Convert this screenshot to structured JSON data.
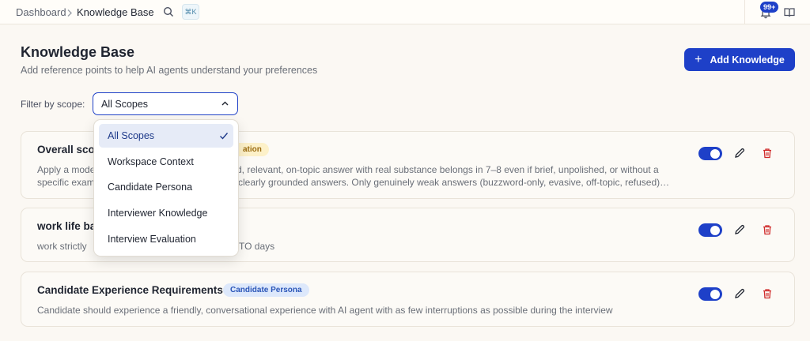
{
  "header": {
    "breadcrumb_root": "Dashboard",
    "breadcrumb_current": "Knowledge Base",
    "shortcut": "⌘K",
    "notification_count": "99+"
  },
  "page": {
    "title": "Knowledge Base",
    "subtitle": "Add reference points to help AI agents understand your preferences",
    "add_label": "Add Knowledge"
  },
  "filter": {
    "label": "Filter by scope:",
    "selected": "All Scopes",
    "options": [
      "All Scopes",
      "Workspace Context",
      "Candidate Persona",
      "Interviewer Knowledge",
      "Interview Evaluation"
    ]
  },
  "cards": [
    {
      "title_visible": "Overall sco",
      "scope_visible": "ation",
      "desc_line1_left": "Apply a mode",
      "desc_line1_right": "d, relevant, on-topic answer with real substance belongs in 7–8 even if brief, unpolished, or without a",
      "desc_line2_left": "specific exam",
      "desc_line2_right": "clearly grounded answers. Only genuinely weak answers (buzzword-only, evasive, off-topic, refused)…",
      "enabled": true
    },
    {
      "title_visible": "work life ba",
      "desc_left": "work strictly",
      "desc_right": "TO days",
      "enabled": true
    },
    {
      "title": "Candidate Experience Requirements",
      "scope": "Candidate Persona",
      "desc": "Candidate should experience a friendly, conversational experience with AI agent with as few interruptions as possible during the interview",
      "enabled": true
    }
  ],
  "colors": {
    "primary": "#1e40c8",
    "delete": "#d02b2b",
    "evaluation_badge_bg": "#fdf1c9",
    "evaluation_badge_text": "#9a6b10",
    "persona_badge_bg": "#dde8fb",
    "persona_badge_text": "#2b56b8"
  }
}
